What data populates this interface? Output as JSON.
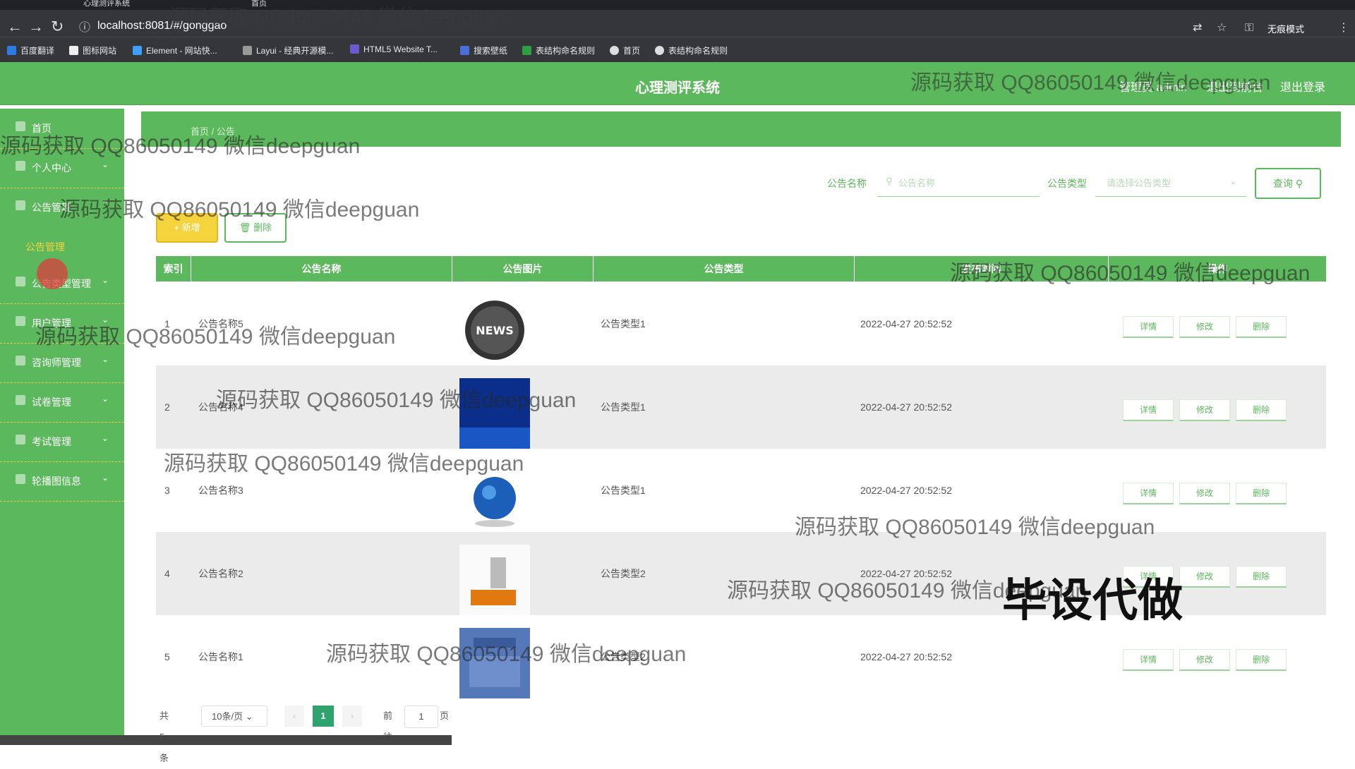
{
  "browser": {
    "tabs": [
      "心理测评系统",
      "首页"
    ],
    "url": "localhost:8081/#/gonggao",
    "incognito_label": "无痕模式",
    "bookmarks": [
      "百度翻译",
      "图标网站",
      "Element - 网站快...",
      "Layui - 经典开源模...",
      "HTML5 Website T...",
      "搜索壁纸",
      "表结构命名规则",
      "首页",
      "表结构命名规则"
    ]
  },
  "header": {
    "title": "心理测评系统",
    "admin_label": "管理员 admin",
    "back_label": "退出到前台",
    "logout_label": "退出登录"
  },
  "sidebar": {
    "items": [
      {
        "label": "首页",
        "has_chevron": false
      },
      {
        "label": "个人中心",
        "has_chevron": true
      },
      {
        "label": "公告管理",
        "has_chevron": true
      },
      {
        "label": "公告类型管理",
        "has_chevron": true
      },
      {
        "label": "用户管理",
        "has_chevron": true
      },
      {
        "label": "咨询师管理",
        "has_chevron": true
      },
      {
        "label": "试卷管理",
        "has_chevron": true
      },
      {
        "label": "考试管理",
        "has_chevron": true
      },
      {
        "label": "轮播图信息",
        "has_chevron": true
      }
    ],
    "active_sub": "公告管理"
  },
  "main": {
    "breadcrumb": "首页 / 公告",
    "filters": {
      "name_label": "公告名称",
      "name_placeholder": "公告名称",
      "type_label": "公告类型",
      "type_placeholder": "请选择公告类型",
      "query_label": "查询"
    },
    "add_label": "+ 新增",
    "delete_label": "删除",
    "table": {
      "columns": [
        "索引",
        "公告名称",
        "公告图片",
        "公告类型",
        "发布时间",
        "操作"
      ],
      "rows": [
        {
          "index": "1",
          "name": "公告名称5",
          "type": "公告类型1",
          "time": "2022-04-27 20:52:52",
          "image": "news-globe-icon"
        },
        {
          "index": "2",
          "name": "公告名称4",
          "type": "公告类型1",
          "time": "2022-04-27 20:52:52",
          "image": "shizheng-news-banner"
        },
        {
          "index": "3",
          "name": "公告名称3",
          "type": "公告类型1",
          "time": "2022-04-27 20:52:52",
          "image": "news-earth-icon"
        },
        {
          "index": "4",
          "name": "公告名称2",
          "type": "公告类型2",
          "time": "2022-04-27 20:52:52",
          "image": "news-3d-text"
        },
        {
          "index": "5",
          "name": "公告名称1",
          "type": "公告类型2",
          "time": "2022-04-27 20:52:52",
          "image": "bbc-world-news"
        }
      ],
      "actions": [
        "详情",
        "修改",
        "删除"
      ]
    },
    "pagination": {
      "total_label": "共 5 条",
      "page_size": "10条/页",
      "current_page": "1",
      "goto_label": "前往",
      "goto_value": "1",
      "page_suffix": "页"
    }
  },
  "watermarks": {
    "text": "源码获取 QQ86050149 微信deepguan",
    "big": "毕设代做"
  },
  "colors": {
    "primary": "#5cb85c",
    "accent": "#f5d33c"
  }
}
